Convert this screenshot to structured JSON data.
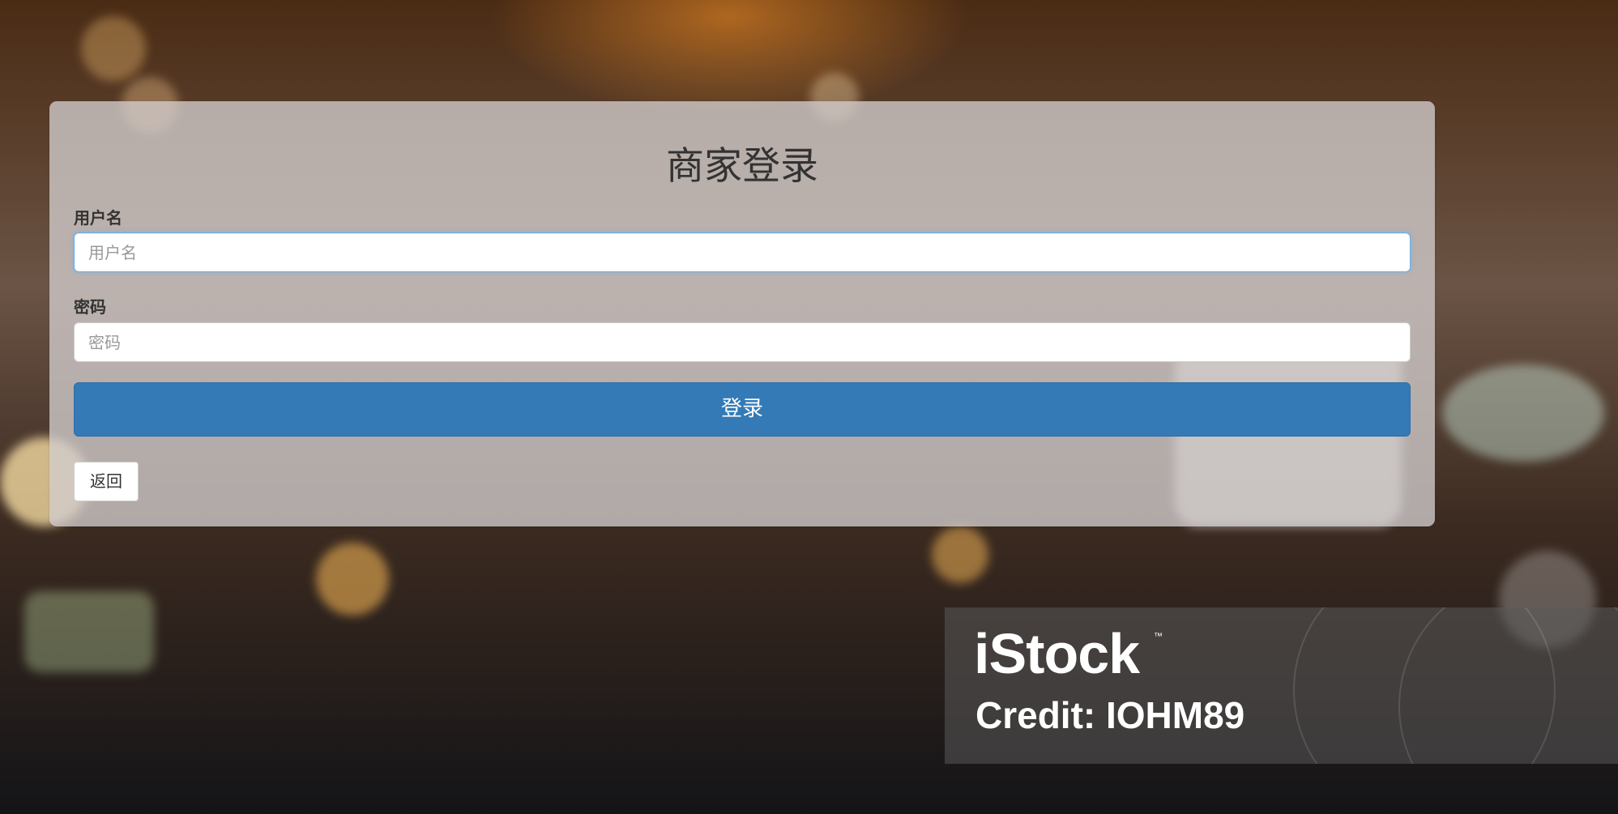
{
  "form": {
    "title": "商家登录",
    "username": {
      "label": "用户名",
      "placeholder": "用户名",
      "value": ""
    },
    "password": {
      "label": "密码",
      "placeholder": "密码",
      "value": ""
    },
    "login_label": "登录",
    "back_label": "返回"
  },
  "watermark": {
    "brand": "iStock",
    "trademark": "™",
    "credit": "Credit: IOHM89"
  },
  "colors": {
    "primary_button": "#337ab7",
    "panel": "#d2cdcd",
    "focus_border": "#66afe9"
  }
}
